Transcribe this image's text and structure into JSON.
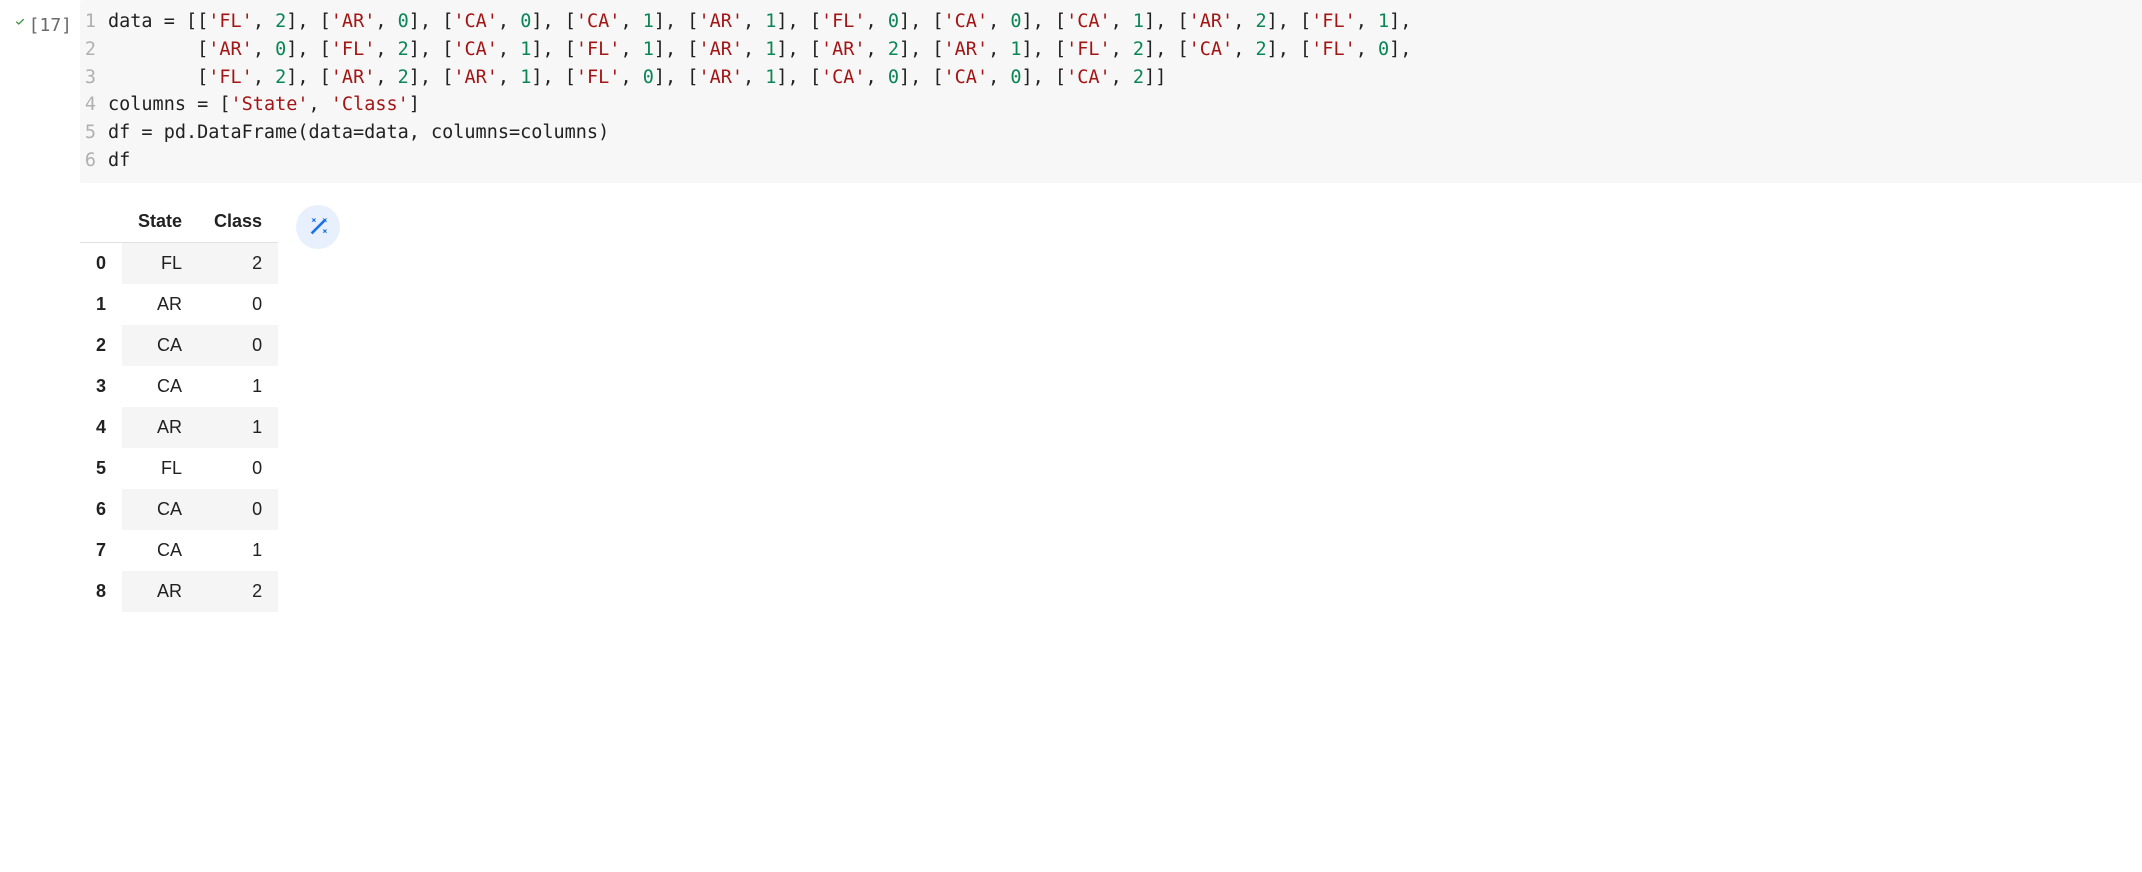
{
  "cell": {
    "execution_count": "[17]",
    "code_lines": [
      "data = [['FL', 2], ['AR', 0], ['CA', 0], ['CA', 1], ['AR', 1], ['FL', 0], ['CA', 0], ['CA', 1], ['AR', 2], ['FL', 1],",
      "        ['AR', 0], ['FL', 2], ['CA', 1], ['FL', 1], ['AR', 1], ['AR', 2], ['AR', 1], ['FL', 2], ['CA', 2], ['FL', 0],",
      "        ['FL', 2], ['AR', 2], ['AR', 1], ['FL', 0], ['AR', 1], ['CA', 0], ['CA', 0], ['CA', 2]]",
      "columns = ['State', 'Class']",
      "df = pd.DataFrame(data=data, columns=columns)",
      "df"
    ]
  },
  "output": {
    "columns": [
      "State",
      "Class"
    ],
    "rows": [
      {
        "idx": "0",
        "State": "FL",
        "Class": "2"
      },
      {
        "idx": "1",
        "State": "AR",
        "Class": "0"
      },
      {
        "idx": "2",
        "State": "CA",
        "Class": "0"
      },
      {
        "idx": "3",
        "State": "CA",
        "Class": "1"
      },
      {
        "idx": "4",
        "State": "AR",
        "Class": "1"
      },
      {
        "idx": "5",
        "State": "FL",
        "Class": "0"
      },
      {
        "idx": "6",
        "State": "CA",
        "Class": "0"
      },
      {
        "idx": "7",
        "State": "CA",
        "Class": "1"
      },
      {
        "idx": "8",
        "State": "AR",
        "Class": "2"
      }
    ]
  },
  "icons": {
    "magic": "magic-wand"
  }
}
